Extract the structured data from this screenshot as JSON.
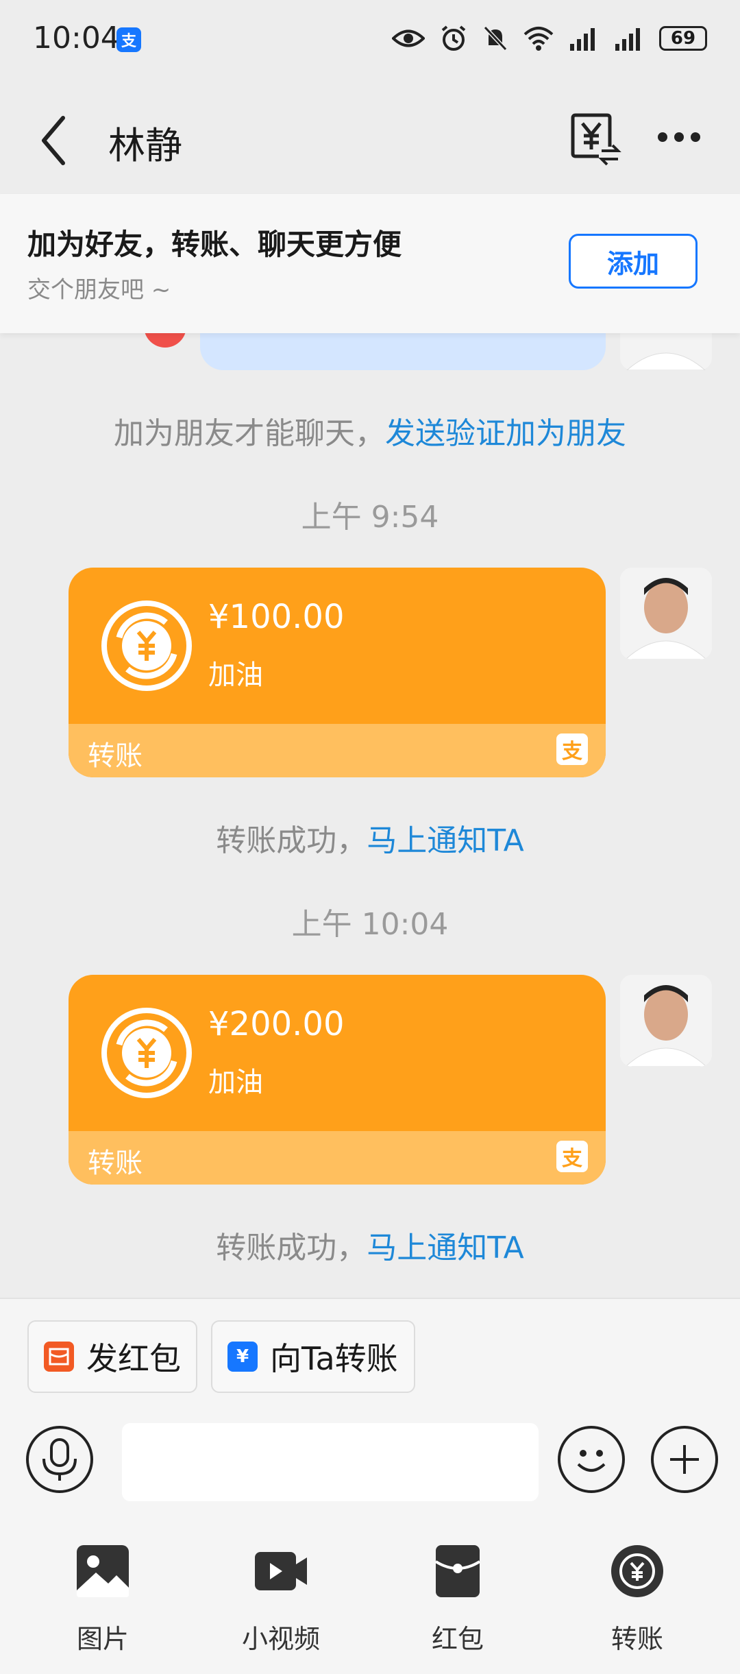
{
  "status_bar": {
    "time": "10:04",
    "battery": "69",
    "app_badge": "支"
  },
  "header": {
    "title": "林静"
  },
  "banner": {
    "title": "加为好友，转账、聊天更方便",
    "subtitle": "交个朋友吧 ~",
    "add_button": "添加"
  },
  "chat": {
    "friend_notice_prefix": "加为朋友才能聊天，",
    "friend_notice_link": "发送验证加为朋友",
    "messages": [
      {
        "time": "上午 9:54",
        "amount": "¥100.00",
        "note": "加油",
        "label": "转账",
        "status_prefix": "转账成功，",
        "status_link": "马上通知TA"
      },
      {
        "time": "上午 10:04",
        "amount": "¥200.00",
        "note": "加油",
        "label": "转账",
        "status_prefix": "转账成功，",
        "status_link": "马上通知TA"
      }
    ]
  },
  "quick_actions": [
    {
      "label": "发红包",
      "icon": "red-envelope-icon",
      "color": "#F25A24"
    },
    {
      "label": "向Ta转账",
      "icon": "transfer-icon",
      "color": "#1677FF"
    }
  ],
  "tools": [
    {
      "label": "图片",
      "icon": "image-icon"
    },
    {
      "label": "小视频",
      "icon": "video-icon"
    },
    {
      "label": "红包",
      "icon": "red-envelope-icon"
    },
    {
      "label": "转账",
      "icon": "transfer-icon"
    }
  ],
  "colors": {
    "card_orange": "#FFA01A",
    "card_footer": "#FFBF5E",
    "link_blue": "#1E88D8",
    "alipay_blue": "#1677FF"
  }
}
